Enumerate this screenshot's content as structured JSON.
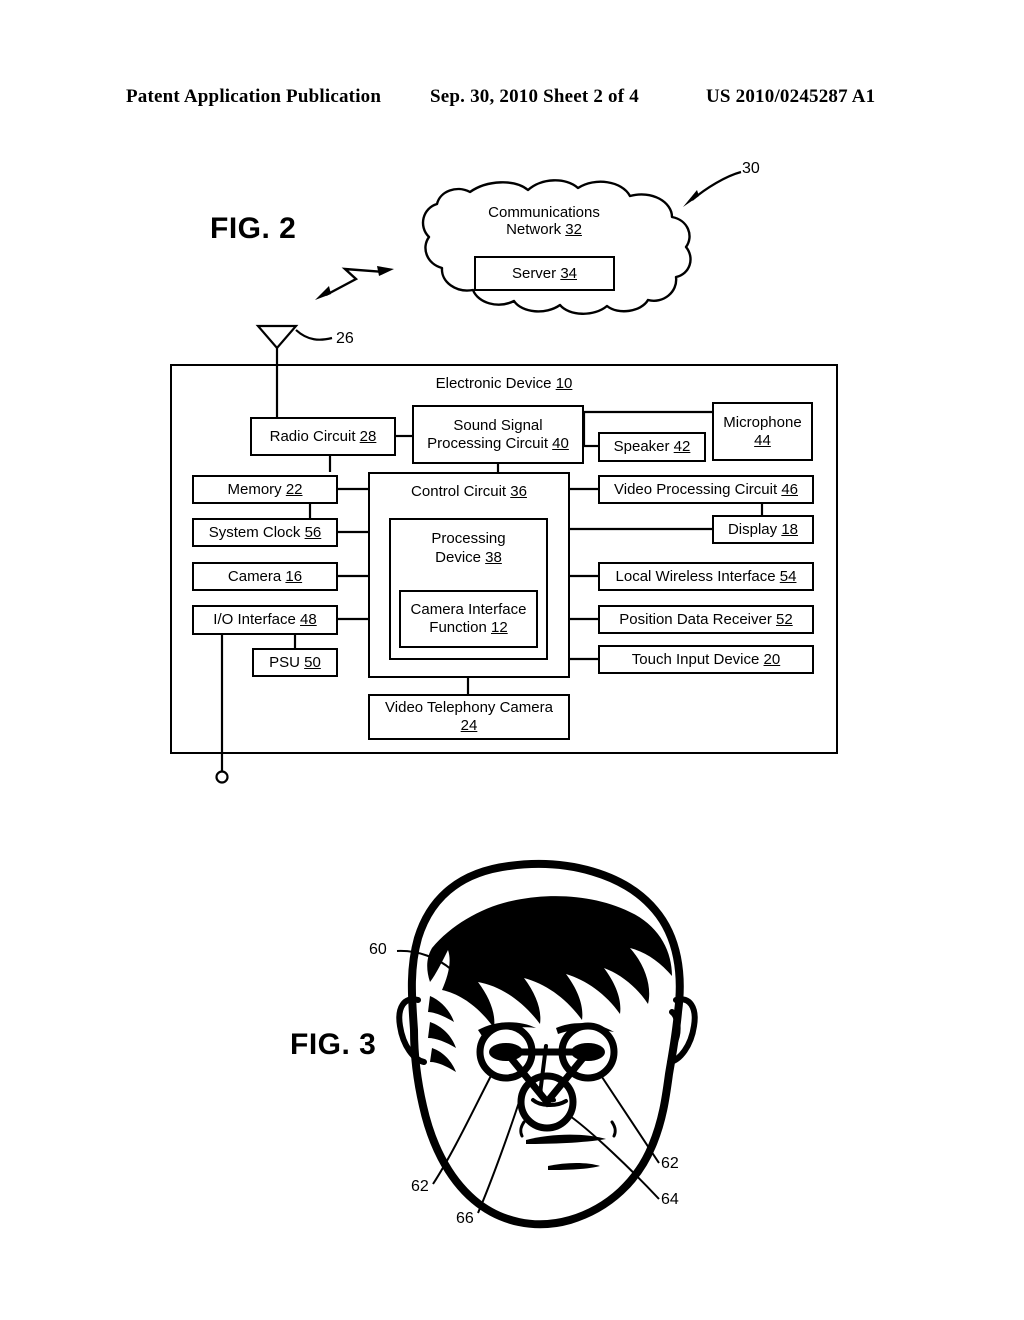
{
  "header": {
    "left": "Patent Application Publication",
    "middle": "Sep. 30, 2010  Sheet 2 of 4",
    "right": "US 2010/0245287 A1"
  },
  "figure2": {
    "label": "FIG. 2",
    "system_ref": "30",
    "antenna_ref": "26",
    "cloud": {
      "title_line1": "Communications",
      "title_line2": "Network",
      "title_ref": "32",
      "server": {
        "label": "Server",
        "ref": "34"
      }
    },
    "device": {
      "title": "Electronic Device",
      "title_ref": "10"
    },
    "blocks": [
      {
        "name": "radio-circuit",
        "label": "Radio Circuit",
        "ref": "28"
      },
      {
        "name": "sound-signal-processing",
        "label": "Sound Signal Processing Circuit",
        "line1": "Sound Signal",
        "line2": "Processing Circuit",
        "ref": "40"
      },
      {
        "name": "speaker",
        "label": "Speaker",
        "ref": "42"
      },
      {
        "name": "microphone",
        "label": "Microphone",
        "ref": "44"
      },
      {
        "name": "memory",
        "label": "Memory",
        "ref": "22"
      },
      {
        "name": "system-clock",
        "label": "System Clock",
        "ref": "56"
      },
      {
        "name": "camera",
        "label": "Camera",
        "ref": "16"
      },
      {
        "name": "io-interface",
        "label": "I/O Interface",
        "ref": "48"
      },
      {
        "name": "psu",
        "label": "PSU",
        "ref": "50"
      },
      {
        "name": "control-circuit",
        "label": "Control Circuit",
        "ref": "36"
      },
      {
        "name": "processing-device",
        "label": "Processing Device",
        "line1": "Processing",
        "line2": "Device",
        "ref": "38"
      },
      {
        "name": "camera-interface-function",
        "label": "Camera Interface Function",
        "line1": "Camera Interface",
        "line2": "Function",
        "ref": "12"
      },
      {
        "name": "video-telephony-camera",
        "label": "Video Telephony Camera",
        "line1": "Video Telephony Camera",
        "ref": "24"
      },
      {
        "name": "video-processing-circuit",
        "label": "Video Processing Circuit",
        "ref": "46"
      },
      {
        "name": "display",
        "label": "Display",
        "ref": "18"
      },
      {
        "name": "local-wireless-interface",
        "label": "Local Wireless Interface",
        "ref": "54"
      },
      {
        "name": "position-data-receiver",
        "label": "Position Data Receiver",
        "ref": "52"
      },
      {
        "name": "touch-input-device",
        "label": "Touch Input Device",
        "ref": "20"
      }
    ]
  },
  "figure3": {
    "label": "FIG. 3",
    "refs": {
      "head": "60",
      "eye_left": "62",
      "eye_right": "62",
      "nose": "64",
      "triangle": "66"
    }
  },
  "colors": {
    "ink": "#000000",
    "paper": "#ffffff"
  }
}
